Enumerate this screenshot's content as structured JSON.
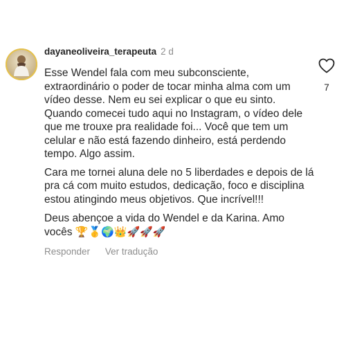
{
  "comment": {
    "username": "dayaneoliveira_terapeuta",
    "time": "2 d",
    "paragraphs": [
      "Esse Wendel fala com meu subconsciente, extraordinário o poder de tocar minha alma com um vídeo desse. Nem eu sei explicar o que eu sinto. Quando comecei tudo aqui no Instagram, o vídeo dele que me trouxe pra realidade foi... Você que tem um celular e não está fazendo dinheiro, está perdendo tempo. Algo assim.",
      "Cara me tornei aluna dele no 5 liberdades e depois de lá pra cá com muito estudos, dedicação, foco e disciplina estou atingindo meus objetivos. Que incrível!!!",
      "Deus abençoe a vida do Wendel e da Karina. Amo vocês"
    ],
    "emojis": "🏆🥇🌍👑🚀🚀🚀",
    "like_count": "7",
    "icons": {
      "like": "heart-outline-icon"
    }
  },
  "actions": {
    "reply_label": "Responder",
    "translate_label": "Ver tradução"
  }
}
